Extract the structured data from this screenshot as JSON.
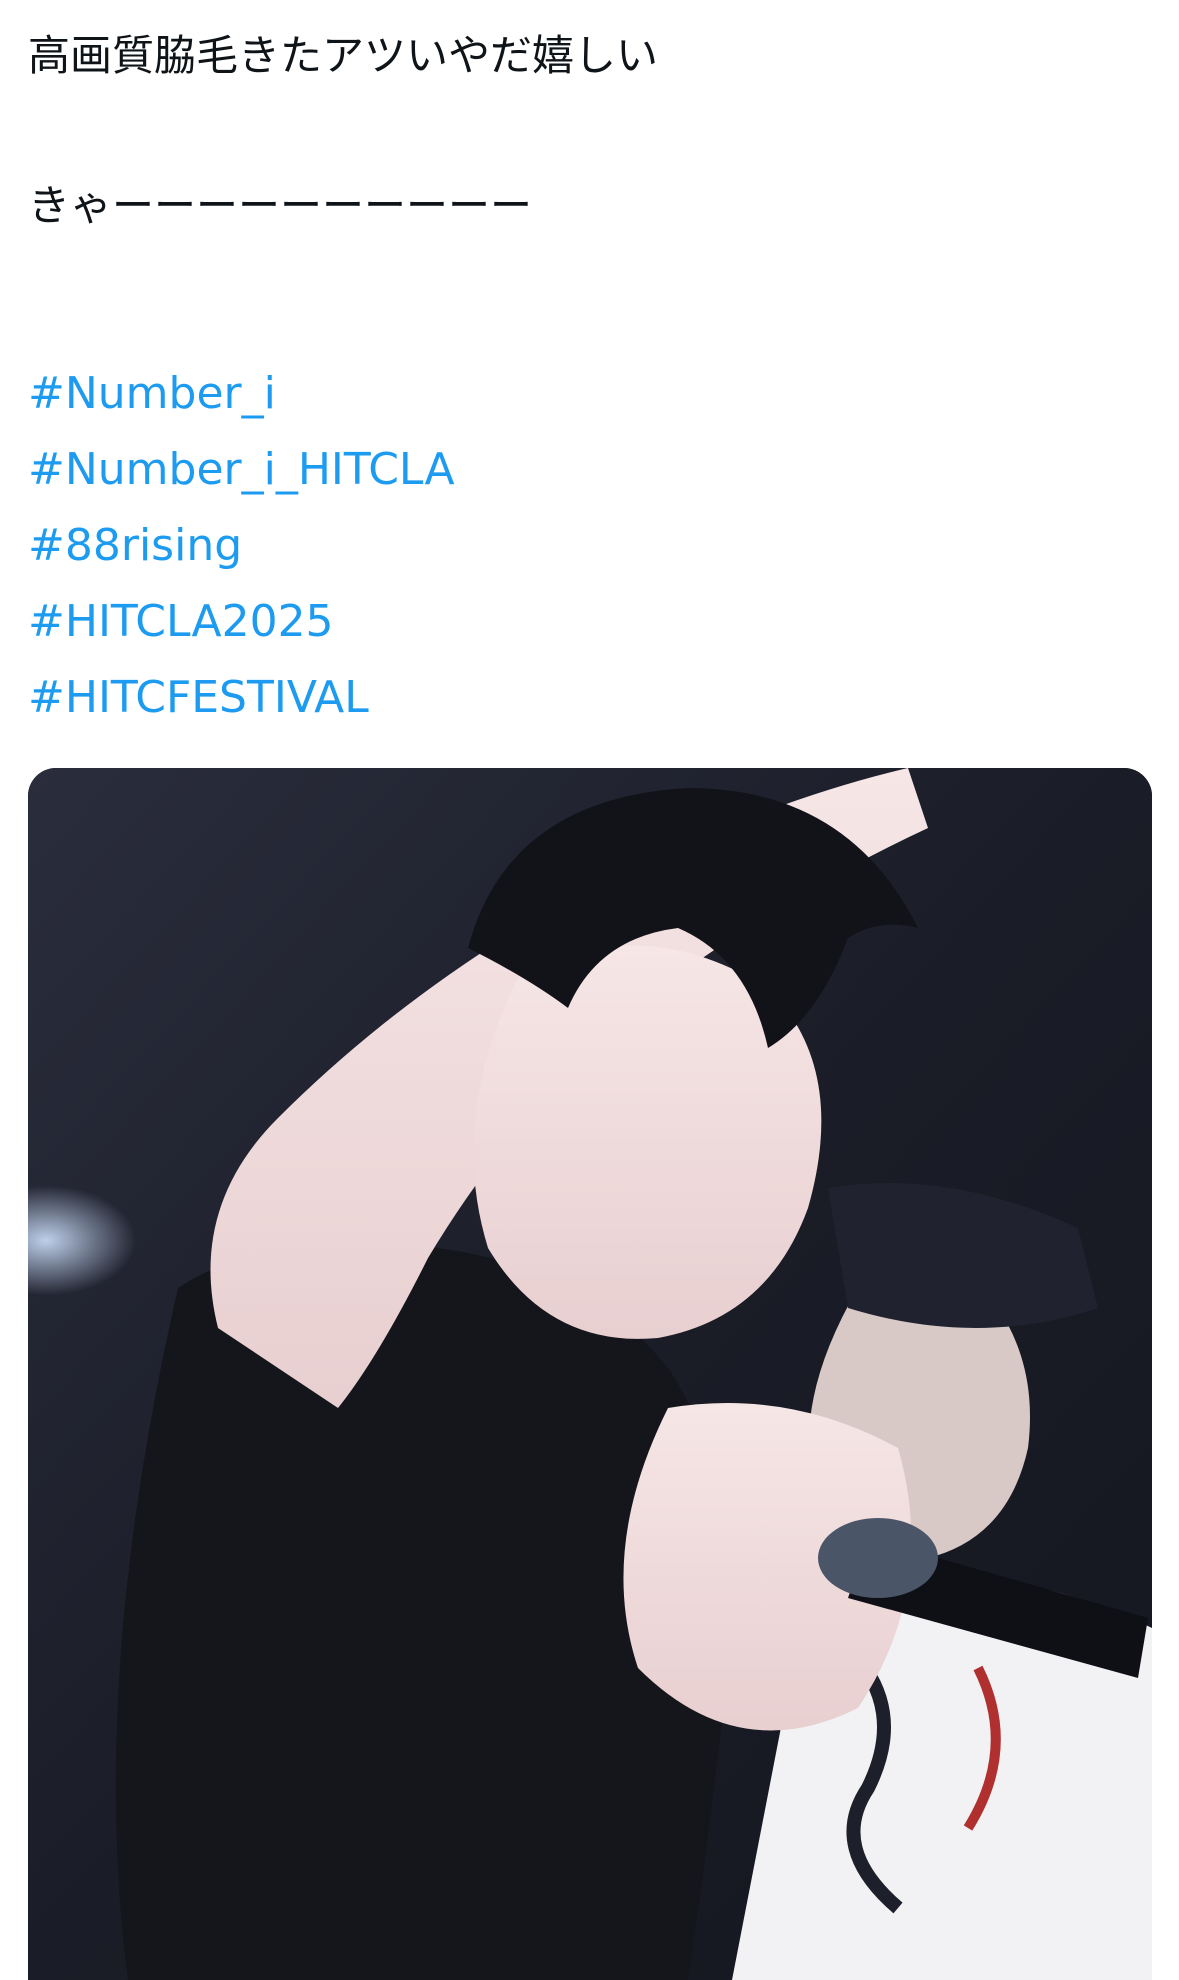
{
  "tweet": {
    "text_line1": "高画質脇毛きたアツいやだ嬉しい",
    "text_line2": "きゃーーーーーーーーーー",
    "hashtags": [
      "#Number_i",
      "#Number_i_HITCLA",
      "#88rising",
      "#HITCLA2025",
      "#HITCFESTIVAL"
    ]
  },
  "media": {
    "type": "photo",
    "alt": "Performer in black sleeveless top raising one arm on stage holding a microphone"
  },
  "colors": {
    "text": "#0f1419",
    "hashtag": "#1d9bf0",
    "background": "#ffffff",
    "photo_backdrop": "#1c1f2b"
  }
}
